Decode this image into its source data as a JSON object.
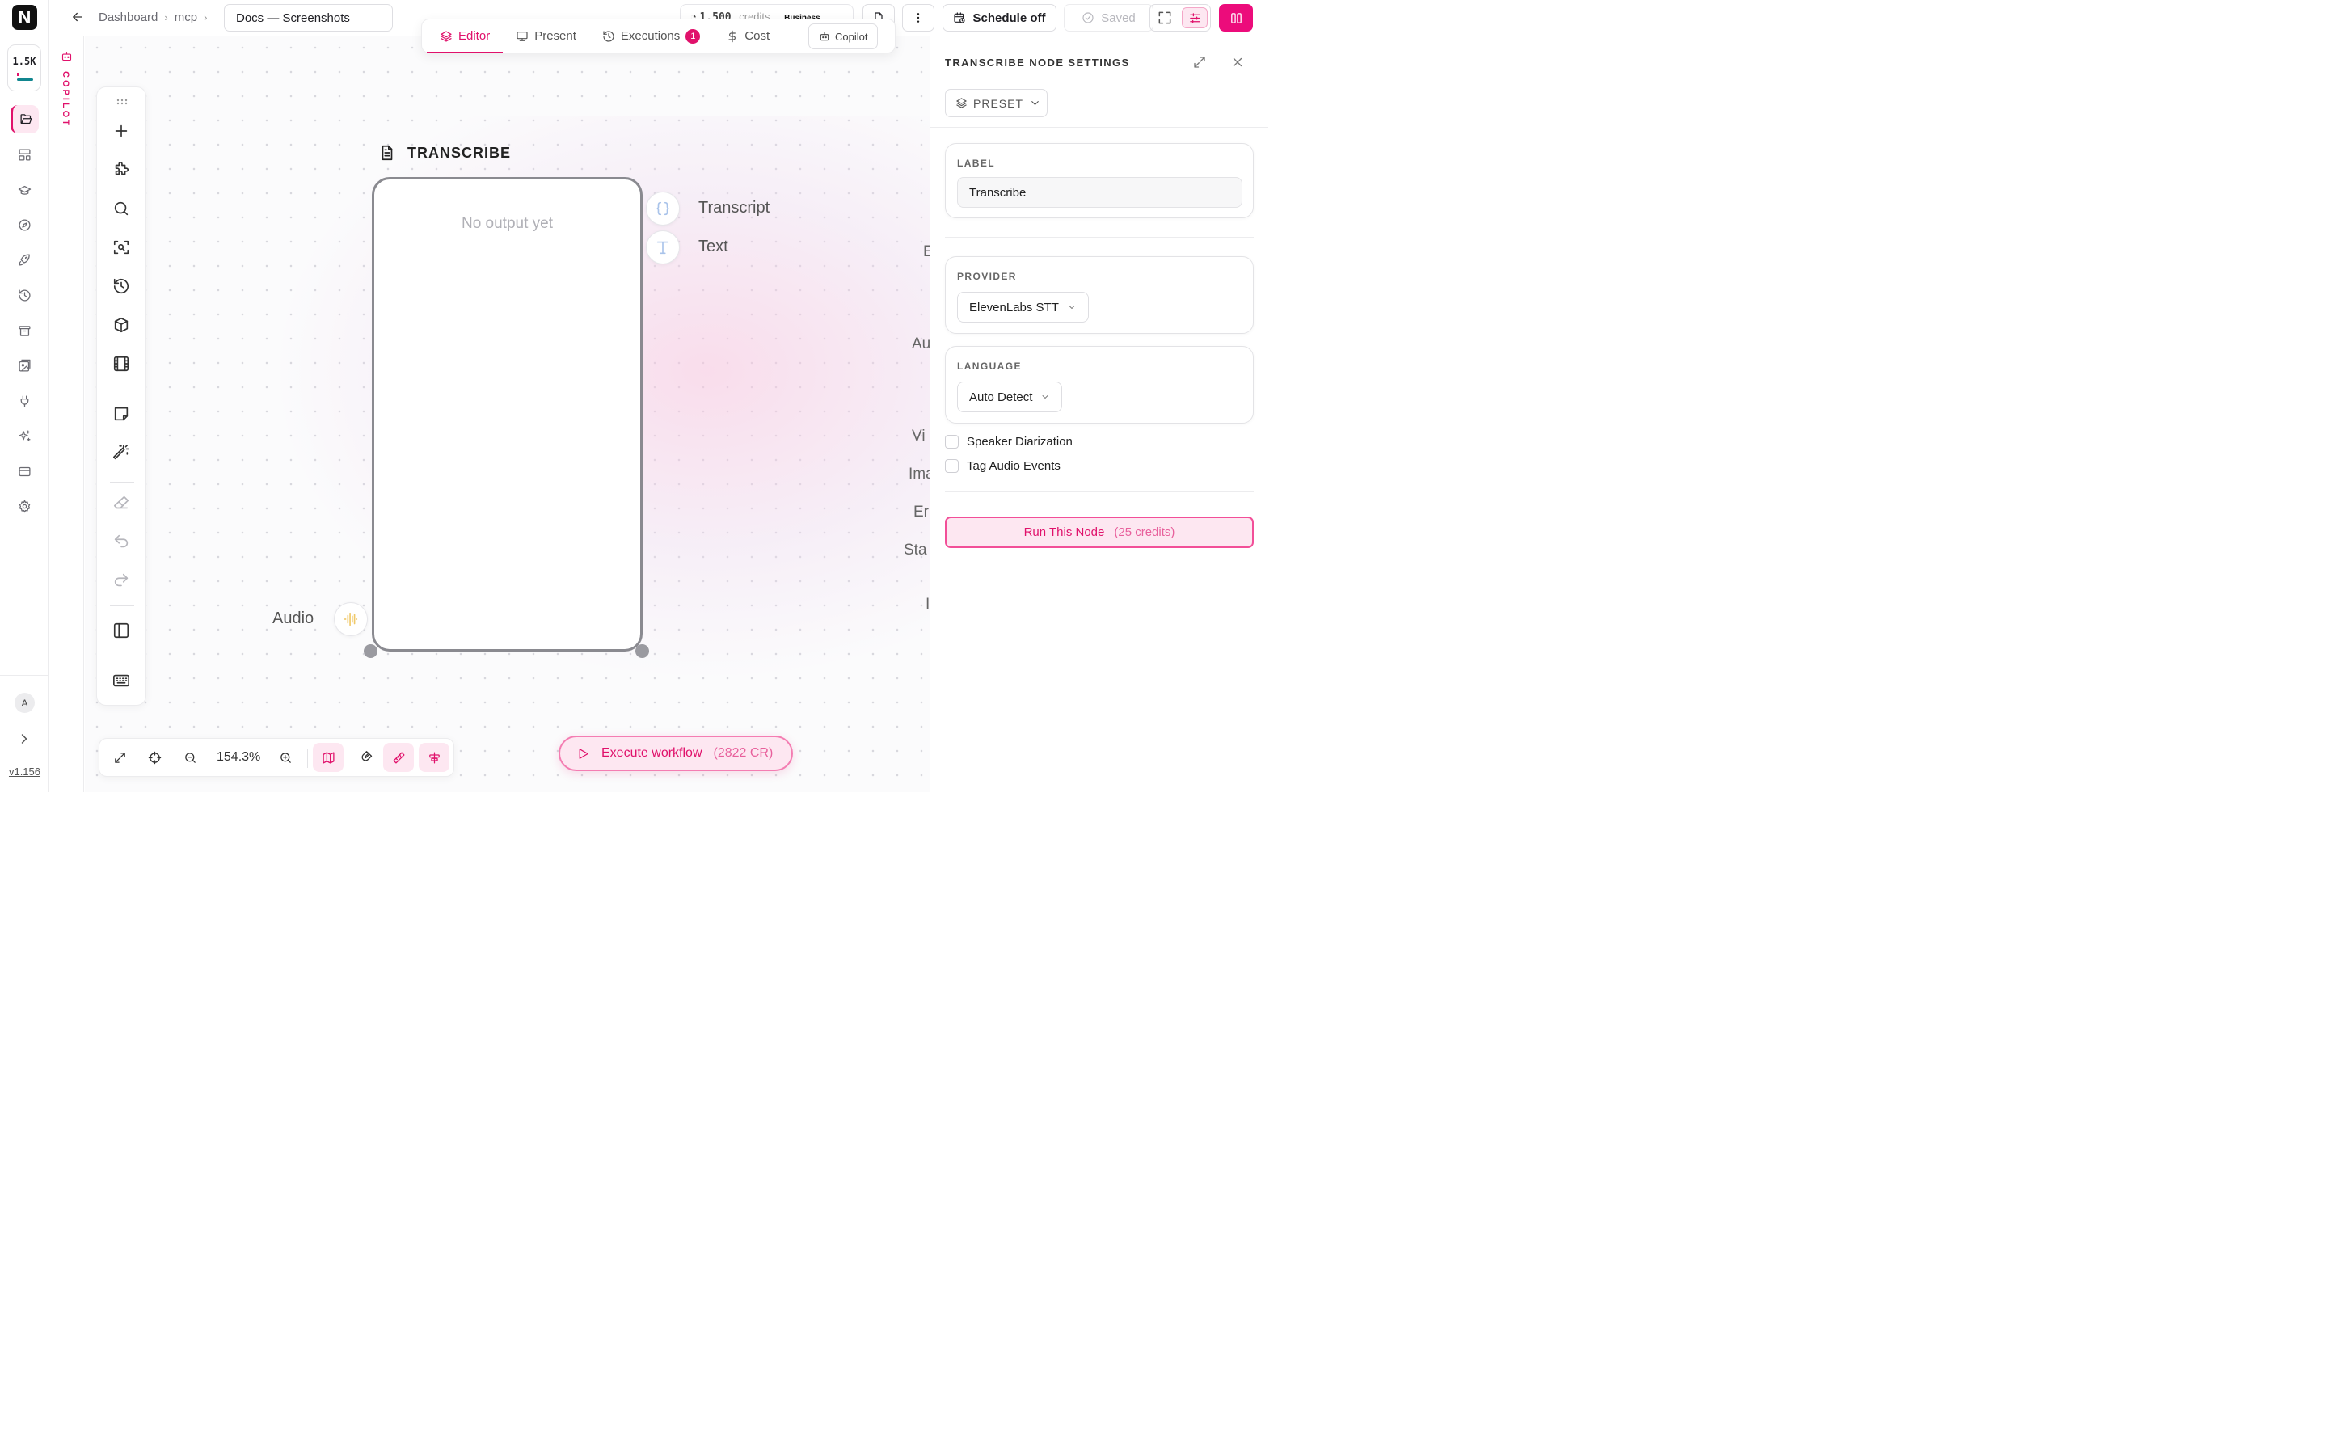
{
  "app": {
    "logo_letter": "N",
    "credit_badge": "1.5K",
    "avatar_initial": "A",
    "version": "v1.156",
    "copilot_strip_label": "COPILOT",
    "accent_color": "#e0116b"
  },
  "rail": {
    "items": [
      {
        "name": "folder-icon",
        "active": true
      },
      {
        "name": "layout-icon",
        "active": false
      },
      {
        "name": "graduation-cap-icon",
        "active": false
      },
      {
        "name": "compass-icon",
        "active": false
      },
      {
        "name": "rocket-icon",
        "active": false
      },
      {
        "name": "history-icon",
        "active": false
      },
      {
        "name": "archive-icon",
        "active": false
      },
      {
        "name": "image-gallery-icon",
        "active": false
      },
      {
        "name": "plug-icon",
        "active": false
      },
      {
        "name": "sparkles-icon",
        "active": false
      },
      {
        "name": "credit-card-icon",
        "active": false
      },
      {
        "name": "settings-icon",
        "active": false
      }
    ]
  },
  "header": {
    "breadcrumb": [
      "Dashboard",
      "mcp"
    ],
    "document_title": "Docs — Screenshots",
    "credits_value": "1,500",
    "credits_label": "credits",
    "plan": "Business",
    "schedule_label": "Schedule off",
    "saved_label": "Saved"
  },
  "mode_tabs": {
    "tabs": [
      {
        "label": "Editor",
        "icon": "layers-icon",
        "active": true
      },
      {
        "label": "Present",
        "icon": "monitor-icon",
        "active": false
      },
      {
        "label": "Executions",
        "icon": "history-icon",
        "active": false,
        "badge": "1"
      },
      {
        "label": "Cost",
        "icon": "dollar-icon",
        "active": false
      }
    ],
    "copilot_label": "Copilot"
  },
  "toolbar": {
    "tools": [
      "plus-icon",
      "puzzle-icon",
      "search-icon",
      "scan-search-icon",
      "history-icon",
      "box-icon",
      "film-icon",
      "note-icon",
      "magic-wand-icon",
      "eraser-icon",
      "undo-icon",
      "redo-icon",
      "sidebar-icon",
      "keyboard-icon"
    ]
  },
  "node": {
    "title": "TRANSCRIBE",
    "empty_text": "No output yet",
    "outputs": [
      {
        "label": "Transcript",
        "icon": "braces-icon"
      },
      {
        "label": "Text",
        "icon": "text-type-icon"
      }
    ],
    "input": {
      "label": "Audio",
      "icon": "audio-wave-icon"
    }
  },
  "canvas": {
    "offscreen_labels": [
      "E",
      "Au",
      "Vi",
      "Ima",
      "Er",
      "Sta",
      "I"
    ]
  },
  "bottom_bar": {
    "zoom": "154.3%"
  },
  "execute": {
    "label": "Execute workflow",
    "credits": "(2822 CR)"
  },
  "panel": {
    "title": "TRANSCRIBE NODE SETTINGS",
    "preset_label": "PRESET",
    "label_field": {
      "label": "LABEL",
      "value": "Transcribe"
    },
    "provider": {
      "label": "PROVIDER",
      "value": "ElevenLabs STT"
    },
    "language": {
      "label": "LANGUAGE",
      "value": "Auto Detect"
    },
    "checkboxes": [
      {
        "label": "Speaker Diarization",
        "checked": false
      },
      {
        "label": "Tag Audio Events",
        "checked": false
      }
    ],
    "run_label": "Run This Node",
    "run_credits": "(25 credits)"
  }
}
